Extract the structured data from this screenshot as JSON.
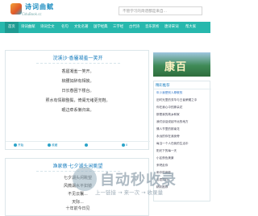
{
  "header": {
    "logo_title": "诗词曲赋",
    "logo_sub": "CiduBook.cc",
    "search_placeholder": "不管学习的简谱都是来自..."
  },
  "nav": {
    "items": [
      "首页",
      "诗词曲赋",
      "诗词全文",
      "名句",
      "文化名著",
      "国学经典",
      "三字经",
      "古代诗",
      "音乐赏析",
      "唐诗宋词",
      "帮大家"
    ]
  },
  "cards": [
    {
      "title": "浣溪沙·香靥凝羞一笑开",
      "lines": [
        "香靥凝羞一笑开。",
        "柳腰如醉有相挨。",
        "日长春困下楼台。",
        "照水有情聊整鬓，倚阑无绪更兜鞋。",
        "眼边牵系懒归来。"
      ],
      "tools": [
        "开始",
        "收藏",
        "",
        "0"
      ]
    },
    {
      "title": "渔家傲·七夕湖头闲眺望",
      "lines": [
        "七夕湖头闲眺望",
        "风微湖水平如镜",
        "不见云鬟...",
        "天际...",
        "龙轩电逝...",
        "一年...",
        "十年前今日见",
        "玄鹤鸟韵兵将上。"
      ]
    }
  ],
  "sidebar": {
    "banner_text": "康百",
    "heading": "精彩推荐",
    "links": [
      "精彩推荐",
      "年少我是别人尊敬的",
      "旧时光里的芳华与王者荣耀之中",
      "你在我心中的那朵花",
      "那是我的故乡和家",
      "我们谈话说起不远的地方",
      "情人节里的那束花",
      "永远的你在我身旁",
      "每当一个人在我的生活中",
      "阳光下的每一天",
      "小区夜色美景",
      "来吧走你",
      "雨中的身影",
      "与君同行"
    ]
  },
  "watermark": {
    "text": "自动秒收录",
    "sub": "上一链接 → 来一次 → 收录量"
  }
}
